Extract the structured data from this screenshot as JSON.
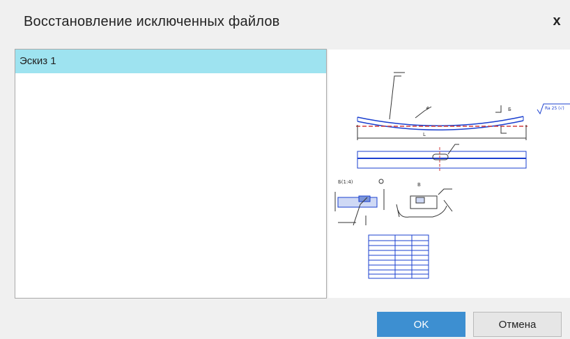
{
  "dialog": {
    "title": "Восстановление исключенных файлов",
    "close_glyph": "x"
  },
  "file_list": {
    "items": [
      {
        "label": "Эскиз 1",
        "selected": true
      }
    ]
  },
  "preview": {
    "roughness_mark": "Ra 25 (√)",
    "section_label": "Б(1:4)",
    "table_rows": 8
  },
  "buttons": {
    "ok_label": "OK",
    "cancel_label": "Отмена"
  },
  "colors": {
    "accent": "#3d8fd1",
    "selection": "#9ee3f0",
    "drawing_blue": "#1a3fcf",
    "drawing_red": "#d23a3a"
  }
}
